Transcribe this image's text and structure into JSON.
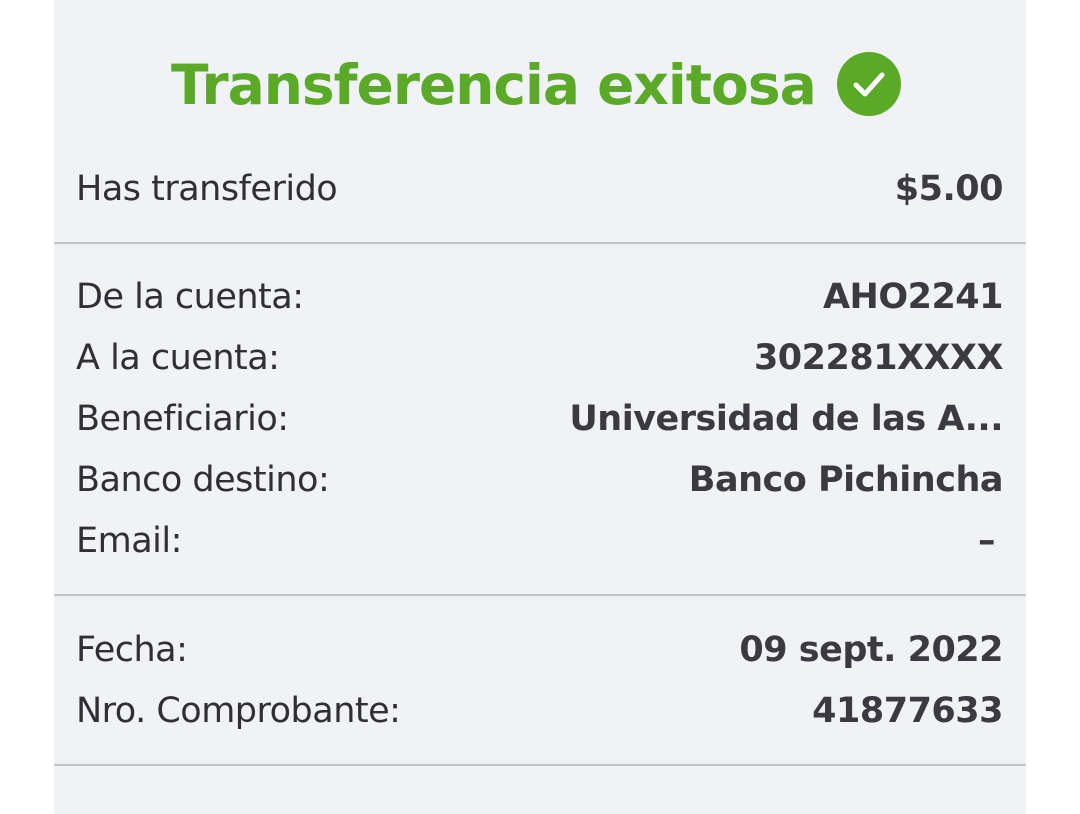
{
  "header": {
    "title": "Transferencia exitosa",
    "status_icon": "check-circle-icon",
    "accent_color": "#5aaa28"
  },
  "amount": {
    "label": "Has transferido",
    "value": "$5.00"
  },
  "transfer_details": [
    {
      "label": "De la cuenta:",
      "value": "AHO2241"
    },
    {
      "label": "A la cuenta:",
      "value": "302281XXXX"
    },
    {
      "label": "Beneficiario:",
      "value": "Universidad de las A..."
    },
    {
      "label": "Banco destino:",
      "value": "Banco Pichincha"
    },
    {
      "label": "Email:",
      "value": "–"
    }
  ],
  "receipt_details": [
    {
      "label": "Fecha:",
      "value": "09 sept. 2022"
    },
    {
      "label": "Nro. Comprobante:",
      "value": "41877633"
    }
  ]
}
